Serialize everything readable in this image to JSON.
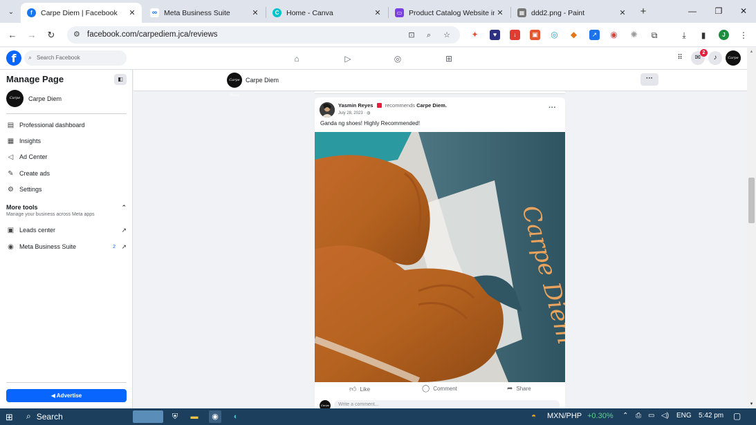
{
  "browser": {
    "tabs": [
      {
        "title": "Carpe Diem | Facebook",
        "icon": "facebook-icon",
        "color": "#1877f2",
        "active": true
      },
      {
        "title": "Meta Business Suite",
        "icon": "meta-icon",
        "color": "#0866ff",
        "active": false
      },
      {
        "title": "Home - Canva",
        "icon": "canva-icon",
        "color": "#00c4cc",
        "active": false
      },
      {
        "title": "Product Catalog Website in",
        "icon": "slides-icon",
        "color": "#7b3fe4",
        "active": false
      },
      {
        "title": "ddd2.png - Paint",
        "icon": "paint-icon",
        "color": "#555555",
        "active": false
      }
    ],
    "url": "facebook.com/carpediem.jca/reviews",
    "profile_initial": "J"
  },
  "fb": {
    "search_placeholder": "Search Facebook",
    "notification_badge": "2",
    "accent": "#0866ff"
  },
  "sidebar": {
    "title": "Manage Page",
    "page_name": "Carpe Diem",
    "items": [
      {
        "label": "Professional dashboard",
        "icon": "dashboard-icon",
        "glyph": "▤"
      },
      {
        "label": "Insights",
        "icon": "insights-icon",
        "glyph": "▦"
      },
      {
        "label": "Ad Center",
        "icon": "megaphone-icon",
        "glyph": "◁"
      },
      {
        "label": "Create ads",
        "icon": "pencil-icon",
        "glyph": "✎"
      },
      {
        "label": "Settings",
        "icon": "gear-icon",
        "glyph": "⚙"
      }
    ],
    "more_tools_title": "More tools",
    "more_tools_sub": "Manage your business across Meta apps",
    "tools": [
      {
        "label": "Leads center",
        "icon": "leads-icon",
        "glyph": "▣",
        "count": ""
      },
      {
        "label": "Meta Business Suite",
        "icon": "meta-suite-icon",
        "glyph": "◉",
        "count": "2"
      }
    ],
    "advertise_label": "Advertise"
  },
  "pagebar": {
    "name": "Carpe Diem",
    "more": "···"
  },
  "post": {
    "author": "Yasmin Reyes",
    "recommends": "recommends",
    "target": "Carpe Diem.",
    "date": "July 28, 2023 · ",
    "text": "Ganda ng shoes! Highly Recommended!",
    "actions": {
      "like": "Like",
      "comment": "Comment",
      "share": "Share"
    },
    "comment_placeholder": "Write a comment...",
    "box_text": "Carpe Diem"
  },
  "taskbar": {
    "search": "Search",
    "ticker": "MXN/PHP",
    "ticker_change": "+0.30%",
    "lang": "ENG",
    "time": "5:42 pm"
  }
}
